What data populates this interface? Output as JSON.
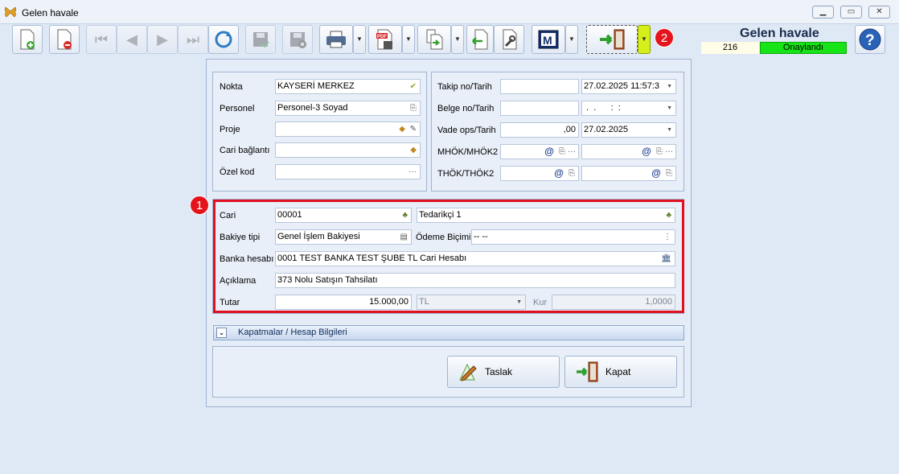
{
  "window": {
    "title": "Gelen havale"
  },
  "header": {
    "title": "Gelen havale",
    "doc_no": "216",
    "status": "Onaylandı",
    "status_color": "#16e416"
  },
  "badges": {
    "one": "1",
    "two": "2"
  },
  "form_left": {
    "nokta_label": "Nokta",
    "nokta_value": "KAYSERİ MERKEZ",
    "personel_label": "Personel",
    "personel_value": "Personel-3 Soyad",
    "proje_label": "Proje",
    "proje_value": "",
    "cari_baglanti_label": "Cari bağlantı",
    "cari_baglanti_value": "",
    "ozel_kod_label": "Özel kod",
    "ozel_kod_value": ""
  },
  "form_right": {
    "takip_label": "Takip no/Tarih",
    "takip_no": "",
    "takip_tarih": "27.02.2025 11:57:3",
    "belge_label": "Belge no/Tarih",
    "belge_no": "",
    "belge_tarih": " .  .      :  :",
    "vade_label": "Vade ops/Tarih",
    "vade_ops": ",00",
    "vade_tarih": "27.02.2025",
    "mhok_label": "MHÖK/MHÖK2",
    "thok_label": "THÖK/THÖK2"
  },
  "main_form": {
    "cari_label": "Cari",
    "cari_code": "00001",
    "cari_name": "Tedarikçi 1",
    "bakiye_label": "Bakiye tipi",
    "bakiye_value": "Genel İşlem Bakiyesi",
    "odeme_label": "Ödeme Biçimi",
    "odeme_value": "-- --",
    "banka_label": "Banka hesabı",
    "banka_value": "0001 TEST BANKA TEST ŞUBE TL Cari Hesabı",
    "aciklama_label": "Açıklama",
    "aciklama_value": "373 Nolu Satışın Tahsilatı",
    "tutar_label": "Tutar",
    "tutar_value": "15.000,00",
    "currency": "TL",
    "kur_label": "Kur",
    "kur_value": "1,0000"
  },
  "expander": {
    "label": "Kapatmalar / Hesap Bilgileri"
  },
  "actions": {
    "taslak_label": "Taslak",
    "kapat_label": "Kapat"
  },
  "icons": {
    "at": "@",
    "ellipsis": "···",
    "dropdown": "▼"
  }
}
